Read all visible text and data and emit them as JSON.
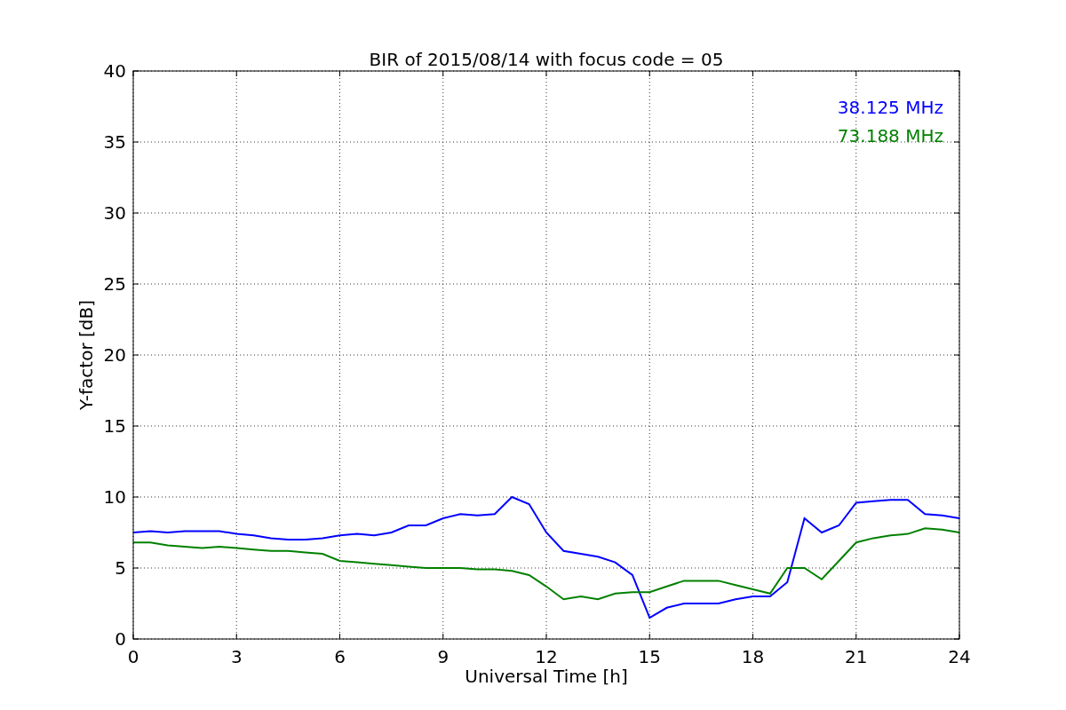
{
  "chart_data": {
    "type": "line",
    "title": "BIR of 2015/08/14 with focus code = 05",
    "xlabel": "Universal Time [h]",
    "ylabel": "Y-factor [dB]",
    "x": [
      0,
      0.5,
      1,
      1.5,
      2,
      2.5,
      3,
      3.5,
      4,
      4.5,
      5,
      5.5,
      6,
      6.5,
      7,
      7.5,
      8,
      8.5,
      9,
      9.5,
      10,
      10.5,
      11,
      11.5,
      12,
      12.5,
      13,
      13.5,
      14,
      14.5,
      15,
      15.5,
      16,
      16.5,
      17,
      17.5,
      18,
      18.5,
      19,
      19.5,
      20,
      20.5,
      21,
      21.5,
      22,
      22.5,
      23,
      23.5,
      24
    ],
    "series": [
      {
        "name": "38.125 MHz",
        "color": "#0000ff",
        "values": [
          7.5,
          7.6,
          7.5,
          7.6,
          7.6,
          7.6,
          7.4,
          7.3,
          7.1,
          7.0,
          7.0,
          7.1,
          7.3,
          7.4,
          7.3,
          7.5,
          8.0,
          8.0,
          8.5,
          8.8,
          8.7,
          8.8,
          10.0,
          9.5,
          7.5,
          6.2,
          6.0,
          5.8,
          5.4,
          4.5,
          1.5,
          2.2,
          2.5,
          2.5,
          2.5,
          2.8,
          3.0,
          3.0,
          4.0,
          8.5,
          7.5,
          8.0,
          9.6,
          9.7,
          9.8,
          9.8,
          8.8,
          8.7,
          8.5
        ]
      },
      {
        "name": "73.188 MHz",
        "color": "#008000",
        "values": [
          6.8,
          6.8,
          6.6,
          6.5,
          6.4,
          6.5,
          6.4,
          6.3,
          6.2,
          6.2,
          6.1,
          6.0,
          5.5,
          5.4,
          5.3,
          5.2,
          5.1,
          5.0,
          5.0,
          5.0,
          4.9,
          4.9,
          4.8,
          4.5,
          3.7,
          2.8,
          3.0,
          2.8,
          3.2,
          3.3,
          3.3,
          3.7,
          4.1,
          4.1,
          4.1,
          3.8,
          3.5,
          3.2,
          5.0,
          5.0,
          4.2,
          5.5,
          6.8,
          7.1,
          7.3,
          7.4,
          7.8,
          7.7,
          7.5
        ]
      }
    ],
    "grid": true,
    "xlim": [
      0,
      24
    ],
    "ylim": [
      0,
      40
    ],
    "xticks": [
      0,
      3,
      6,
      9,
      12,
      15,
      18,
      21,
      24
    ],
    "yticks": [
      0,
      5,
      10,
      15,
      20,
      25,
      30,
      35,
      40
    ]
  }
}
